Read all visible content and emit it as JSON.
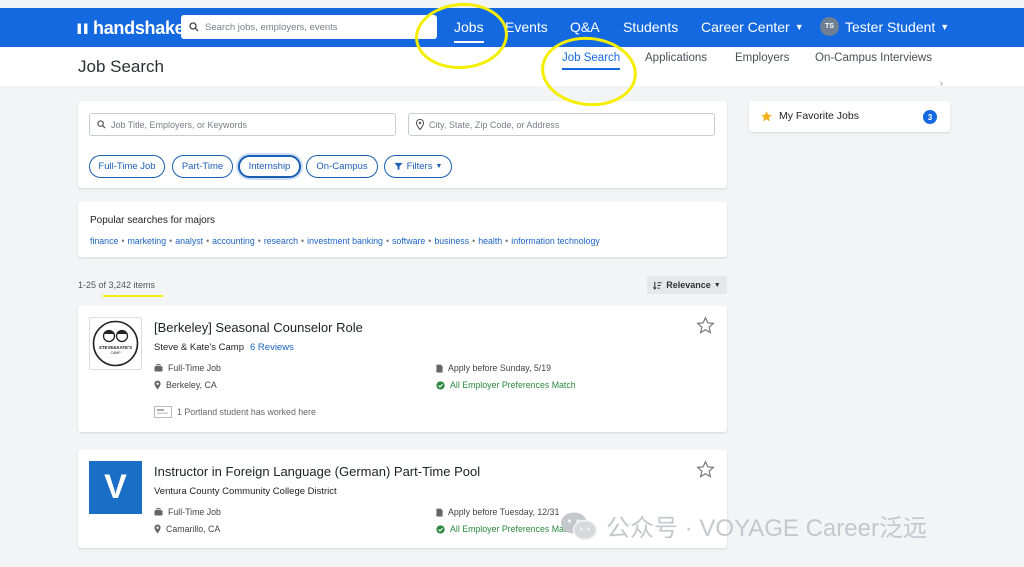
{
  "nav": {
    "logo_text": "handshake",
    "search_placeholder": "Search jobs, employers, events",
    "items": [
      {
        "label": "Jobs"
      },
      {
        "label": "Events"
      },
      {
        "label": "Q&A"
      },
      {
        "label": "Students"
      },
      {
        "label": "Career Center"
      }
    ],
    "avatar_initials": "TS",
    "user_name": "Tester Student"
  },
  "subheader": {
    "title": "Job Search",
    "tabs": [
      {
        "label": "Job Search"
      },
      {
        "label": "Applications"
      },
      {
        "label": "Employers"
      },
      {
        "label": "On-Campus Interviews"
      }
    ]
  },
  "filters": {
    "keyword_placeholder": "Job Title, Employers, or Keywords",
    "location_placeholder": "City, State, Zip Code, or Address",
    "pills": [
      {
        "label": "Full-Time Job"
      },
      {
        "label": "Part-Time"
      },
      {
        "label": "Internship"
      },
      {
        "label": "On-Campus"
      },
      {
        "label": "Filters"
      }
    ]
  },
  "popular": {
    "title": "Popular searches for majors",
    "links": [
      "finance",
      "marketing",
      "analyst",
      "accounting",
      "research",
      "investment banking",
      "software",
      "business",
      "health",
      "information technology"
    ]
  },
  "results": {
    "count_prefix": "1-25 of ",
    "count_value": "3,242 items",
    "sort_label": "Relevance"
  },
  "favorites": {
    "label": "My Favorite Jobs",
    "count": "3"
  },
  "jobs": [
    {
      "title": "[Berkeley] Seasonal Counselor Role",
      "employer": "Steve & Kate's Camp",
      "reviews": "6 Reviews",
      "job_type": "Full-Time Job",
      "location": "Berkeley, CA",
      "apply_by": "Apply before Sunday, 5/19",
      "match": "All Employer Preferences Match",
      "social": "1 Portland student has worked here",
      "logo_text_1": "STEVE&KATE'S",
      "logo_text_2": "CAMP"
    },
    {
      "title": "Instructor in Foreign Language (German) Part-Time Pool",
      "employer": "Ventura County Community College District",
      "job_type": "Full-Time Job",
      "location": "Camarillo, CA",
      "apply_by": "Apply before Tuesday, 12/31",
      "match": "All Employer Preferences Match",
      "logo_letter": "V"
    }
  ],
  "watermark": "公众号 · VOYAGE Career泛远",
  "colors": {
    "brand_blue": "#1569e0",
    "link_blue": "#1c64c4",
    "match_green": "#2a8a3e",
    "highlight_yellow": "#f5ee00",
    "favorite_star": "#f2b01e"
  }
}
